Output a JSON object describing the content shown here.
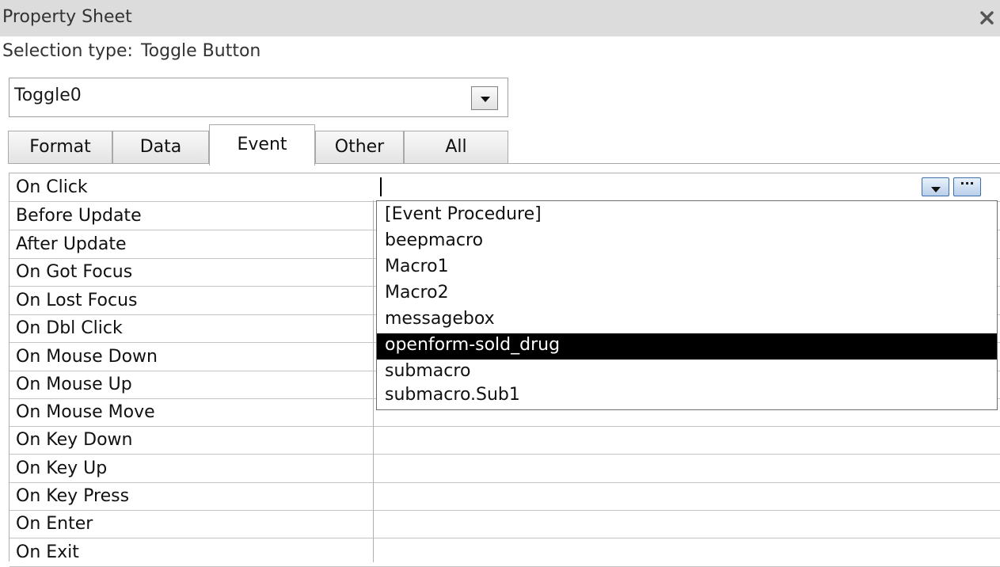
{
  "panel": {
    "title": "Property Sheet",
    "selection_type_label": "Selection type:",
    "selection_type_value": "Toggle Button"
  },
  "selector": {
    "value": "Toggle0"
  },
  "tabs": [
    {
      "label": "Format",
      "active": false
    },
    {
      "label": "Data",
      "active": false
    },
    {
      "label": "Event",
      "active": true
    },
    {
      "label": "Other",
      "active": false
    },
    {
      "label": "All",
      "active": false
    }
  ],
  "properties": [
    {
      "label": "On Click",
      "value": ""
    },
    {
      "label": "Before Update",
      "value": ""
    },
    {
      "label": "After Update",
      "value": ""
    },
    {
      "label": "On Got Focus",
      "value": ""
    },
    {
      "label": "On Lost Focus",
      "value": ""
    },
    {
      "label": "On Dbl Click",
      "value": ""
    },
    {
      "label": "On Mouse Down",
      "value": ""
    },
    {
      "label": "On Mouse Up",
      "value": ""
    },
    {
      "label": "On Mouse Move",
      "value": ""
    },
    {
      "label": "On Key Down",
      "value": ""
    },
    {
      "label": "On Key Up",
      "value": ""
    },
    {
      "label": "On Key Press",
      "value": ""
    },
    {
      "label": "On Enter",
      "value": ""
    },
    {
      "label": "On Exit",
      "value": ""
    }
  ],
  "onclick_dropdown": {
    "builder_label": "···",
    "options": [
      "[Event Procedure]",
      "beepmacro",
      "Macro1",
      "Macro2",
      "messagebox",
      "openform-sold_drug",
      "submacro",
      "submacro.Sub1"
    ],
    "highlighted": "openform-sold_drug"
  },
  "icons": {
    "close": "close-icon",
    "dropdown": "chevron-down-icon",
    "builder": "ellipsis-icon"
  },
  "colors": {
    "title_bar": "#dcdcdc",
    "highlight_bg": "#000000",
    "highlight_text": "#ffffff",
    "button_border": "#3d6ea8"
  }
}
